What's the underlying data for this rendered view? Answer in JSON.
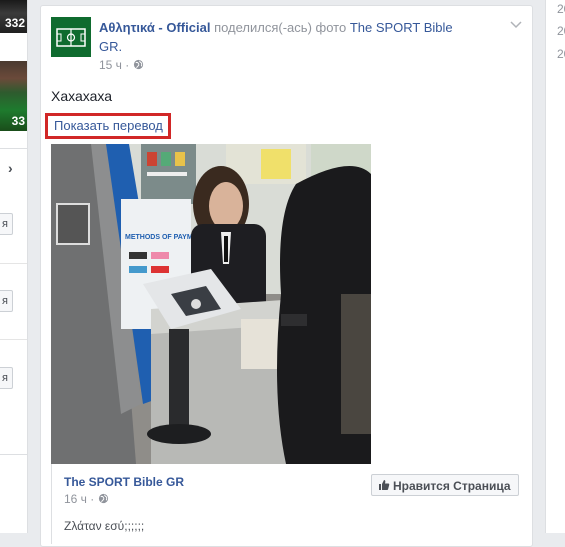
{
  "left": {
    "thumb1_count": "332",
    "thumb2_count": "33",
    "chevron": "›",
    "btn_char": "я"
  },
  "post": {
    "author": "Αθλητικά - Official",
    "action": "поделился(-ась) фото",
    "shared_from": "The SPORT Bible GR.",
    "time": "15 ч",
    "text": "Хахахаха",
    "translate_label": "Показать перевод"
  },
  "shared": {
    "author": "The SPORT Bible GR",
    "time": "16 ч",
    "like_label": "Нравится Страница",
    "text": "Ζλάταν εσύ;;;;;;"
  },
  "photo": {
    "sign_text": "METHODS OF PAYMENT"
  },
  "right": {
    "nums": [
      "20",
      "20",
      "20"
    ]
  },
  "colors": {
    "link": "#365899",
    "highlight_border": "#d12727",
    "background": "#e9ebee"
  }
}
